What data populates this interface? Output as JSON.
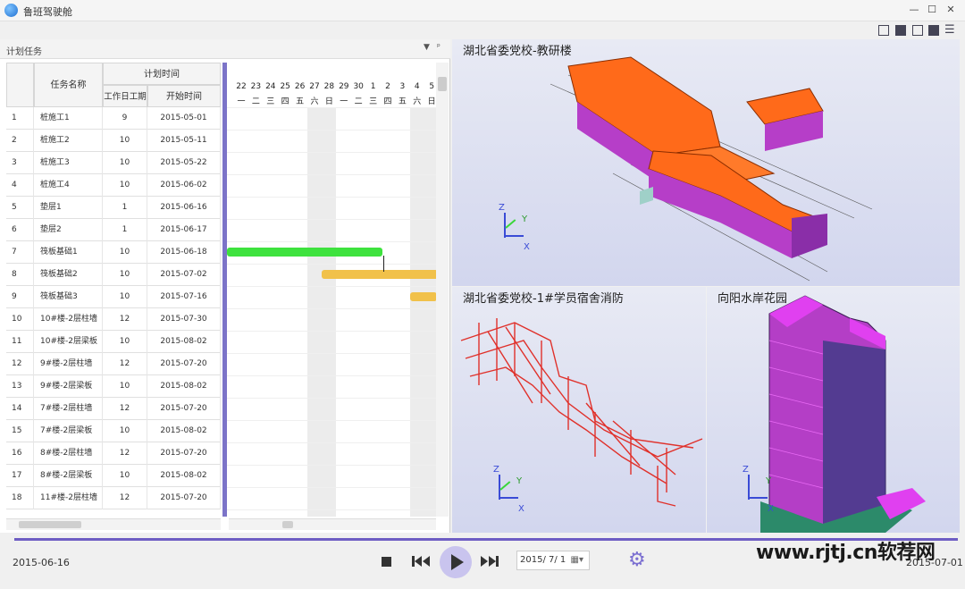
{
  "window": {
    "title": "鲁班驾驶舱"
  },
  "panel": {
    "title": "计划任务",
    "menu_glyph": "▼",
    "pin_glyph": "ᵖ"
  },
  "table": {
    "group_header": "计划时间",
    "col_name": "任务名称",
    "col_duration": "工作日工期",
    "col_start": "开始时间",
    "rows": [
      {
        "num": "1",
        "name": "桩施工1",
        "duration": "9",
        "start": "2015-05-01"
      },
      {
        "num": "2",
        "name": "桩施工2",
        "duration": "10",
        "start": "2015-05-11"
      },
      {
        "num": "3",
        "name": "桩施工3",
        "duration": "10",
        "start": "2015-05-22"
      },
      {
        "num": "4",
        "name": "桩施工4",
        "duration": "10",
        "start": "2015-06-02"
      },
      {
        "num": "5",
        "name": "垫层1",
        "duration": "1",
        "start": "2015-06-16"
      },
      {
        "num": "6",
        "name": "垫层2",
        "duration": "1",
        "start": "2015-06-17"
      },
      {
        "num": "7",
        "name": "筏板基础1",
        "duration": "10",
        "start": "2015-06-18"
      },
      {
        "num": "8",
        "name": "筏板基础2",
        "duration": "10",
        "start": "2015-07-02"
      },
      {
        "num": "9",
        "name": "筏板基础3",
        "duration": "10",
        "start": "2015-07-16"
      },
      {
        "num": "10",
        "name": "10#楼-2层柱墙",
        "duration": "12",
        "start": "2015-07-30"
      },
      {
        "num": "11",
        "name": "10#楼-2层梁板",
        "duration": "10",
        "start": "2015-08-02"
      },
      {
        "num": "12",
        "name": "9#楼-2层柱墙",
        "duration": "12",
        "start": "2015-07-20"
      },
      {
        "num": "13",
        "name": "9#楼-2层梁板",
        "duration": "10",
        "start": "2015-08-02"
      },
      {
        "num": "14",
        "name": "7#楼-2层柱墙",
        "duration": "12",
        "start": "2015-07-20"
      },
      {
        "num": "15",
        "name": "7#楼-2层梁板",
        "duration": "10",
        "start": "2015-08-02"
      },
      {
        "num": "16",
        "name": "8#楼-2层柱墙",
        "duration": "12",
        "start": "2015-07-20"
      },
      {
        "num": "17",
        "name": "8#楼-2层梁板",
        "duration": "10",
        "start": "2015-08-02"
      },
      {
        "num": "18",
        "name": "11#楼-2层柱墙",
        "duration": "12",
        "start": "2015-07-20"
      }
    ]
  },
  "gantt": {
    "days": [
      "22",
      "23",
      "24",
      "25",
      "26",
      "27",
      "28",
      "29",
      "30",
      "1",
      "2",
      "3",
      "4",
      "5"
    ],
    "weekdays": [
      "一",
      "二",
      "三",
      "四",
      "五",
      "六",
      "日",
      "一",
      "二",
      "三",
      "四",
      "五",
      "六",
      "日"
    ],
    "bar_colors": {
      "active": "#3ee23e",
      "planned": "#f1c14a"
    }
  },
  "viewports": {
    "top": {
      "title": "湖北省委党校-教研楼"
    },
    "bottom_left": {
      "title": "湖北省委党校-1#学员宿舍消防"
    },
    "bottom_right": {
      "title": "向阳水岸花园"
    },
    "axes": {
      "x": "X",
      "y": "Y",
      "z": "Z"
    }
  },
  "playback": {
    "start_date": "2015-06-16",
    "end_date": "2015-07-01",
    "current_date": "2015/ 7/ 1"
  },
  "watermark": "www.rjtj.cn软荐网"
}
